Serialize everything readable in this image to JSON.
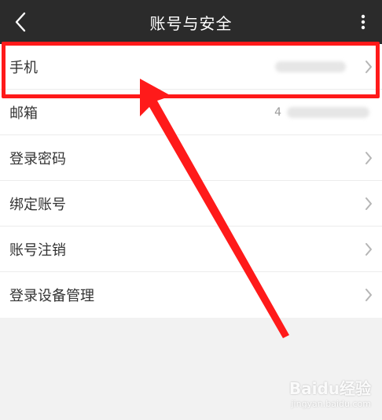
{
  "header": {
    "title": "账号与安全",
    "back_icon": "back-chevron-icon",
    "more_icon": "vertical-ellipsis-icon",
    "background": "#2b2b2b"
  },
  "settings": {
    "items": [
      {
        "label": "手机",
        "value": "",
        "icon": "chevron-right-icon"
      },
      {
        "label": "邮箱",
        "value": "4",
        "icon": ""
      },
      {
        "label": "登录密码",
        "value": "",
        "icon": "chevron-right-icon"
      },
      {
        "label": "绑定账号",
        "value": "",
        "icon": "chevron-right-icon"
      },
      {
        "label": "账号注销",
        "value": "",
        "icon": "chevron-right-icon"
      },
      {
        "label": "登录设备管理",
        "value": "",
        "icon": "chevron-right-icon"
      }
    ]
  },
  "annotation": {
    "highlight_color": "#ff1a1a"
  },
  "watermark": {
    "logo": "Baidu经验",
    "url": "jingyan.baidu.com"
  }
}
